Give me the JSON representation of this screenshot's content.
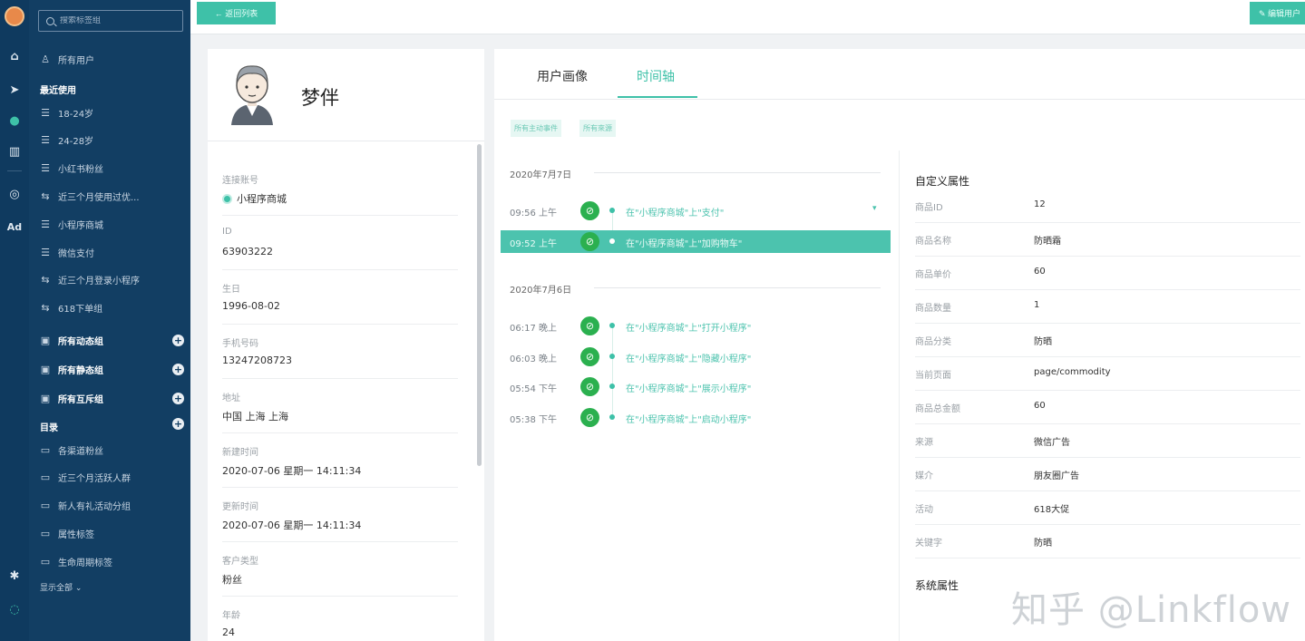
{
  "rail": {
    "icons": [
      "logo-icon",
      "home-icon",
      "send-icon",
      "user-icon",
      "bar-chart-icon",
      "chat-icon",
      "ad-icon",
      "settings-icon",
      "message-icon"
    ],
    "ad_label": "Ad"
  },
  "sidebar": {
    "search_placeholder": "搜索标签组",
    "all_users": "所有用户",
    "recent_header": "最近使用",
    "recent": [
      {
        "icon": "list-icon",
        "label": "18-24岁"
      },
      {
        "icon": "list-icon",
        "label": "24-28岁"
      },
      {
        "icon": "list-icon",
        "label": "小红书粉丝"
      },
      {
        "icon": "sync-icon",
        "label": "近三个月使用过优..."
      },
      {
        "icon": "list-icon",
        "label": "小程序商城"
      },
      {
        "icon": "list-icon",
        "label": "微信支付"
      },
      {
        "icon": "sync-icon",
        "label": "近三个月登录小程序"
      },
      {
        "icon": "sync-icon",
        "label": "618下单组"
      }
    ],
    "groups": [
      {
        "label": "所有动态组"
      },
      {
        "label": "所有静态组"
      },
      {
        "label": "所有互斥组"
      }
    ],
    "catalog_header": "目录",
    "folders": [
      "各渠道粉丝",
      "近三个月活跃人群",
      "新人有礼活动分组",
      "属性标签",
      "生命周期标签"
    ],
    "show_all": "显示全部 ⌄"
  },
  "topbar": {
    "back_label": "← 返回列表",
    "edit_label": "✎ 编辑用户"
  },
  "profile": {
    "name": "梦伴",
    "fields": [
      {
        "label": "连接账号",
        "value": "小程序商城",
        "has_dot": true
      },
      {
        "label": "ID",
        "value": "63903222"
      },
      {
        "label": "生日",
        "value": "1996-08-02"
      },
      {
        "label": "手机号码",
        "value": "13247208723"
      },
      {
        "label": "地址",
        "value": "中国 上海 上海"
      },
      {
        "label": "新建时间",
        "value": "2020-07-06 星期一 14:11:34"
      },
      {
        "label": "更新时间",
        "value": "2020-07-06 星期一 14:11:34"
      },
      {
        "label": "客户类型",
        "value": "粉丝"
      },
      {
        "label": "年龄",
        "value": "24"
      }
    ]
  },
  "main": {
    "tabs": [
      "用户画像",
      "时间轴"
    ],
    "active_tab": "时间轴",
    "chips": [
      "所有主动事件",
      "所有來源"
    ],
    "timeline": [
      {
        "date": "2020年7月7日",
        "events": [
          {
            "time": "09:56 上午",
            "desc": "在\"小程序商城\"上\"支付\"",
            "selected": false,
            "expand": true
          },
          {
            "time": "09:52 上午",
            "desc": "在\"小程序商城\"上\"加购物车\"",
            "selected": true
          }
        ]
      },
      {
        "date": "2020年7月6日",
        "events": [
          {
            "time": "06:17 晚上",
            "desc": "在\"小程序商城\"上\"打开小程序\"",
            "selected": false
          },
          {
            "time": "06:03 晚上",
            "desc": "在\"小程序商城\"上\"隐藏小程序\"",
            "selected": false
          },
          {
            "time": "05:54 下午",
            "desc": "在\"小程序商城\"上\"展示小程序\"",
            "selected": false
          },
          {
            "time": "05:38 下午",
            "desc": "在\"小程序商城\"上\"启动小程序\"",
            "selected": false
          }
        ]
      }
    ],
    "custom_props_title": "自定义属性",
    "custom_props": [
      {
        "key": "商品ID",
        "value": "12"
      },
      {
        "key": "商品名称",
        "value": "防晒霜"
      },
      {
        "key": "商品单价",
        "value": "60"
      },
      {
        "key": "商品数量",
        "value": "1"
      },
      {
        "key": "商品分类",
        "value": "防晒"
      },
      {
        "key": "当前页面",
        "value": "page/commodity"
      },
      {
        "key": "商品总金额",
        "value": "60"
      },
      {
        "key": "来源",
        "value": "微信广告"
      },
      {
        "key": "媒介",
        "value": "朋友圈广告"
      },
      {
        "key": "活动",
        "value": "618大促"
      },
      {
        "key": "关键字",
        "value": "防晒"
      }
    ],
    "system_props_title": "系统属性"
  },
  "watermark": "知乎 @Linkflow",
  "colors": {
    "accent": "#3ec1a8",
    "sidebar_bg": "#123e63",
    "rail_bg": "#0f3a5f",
    "event_icon": "#2bb04f"
  }
}
